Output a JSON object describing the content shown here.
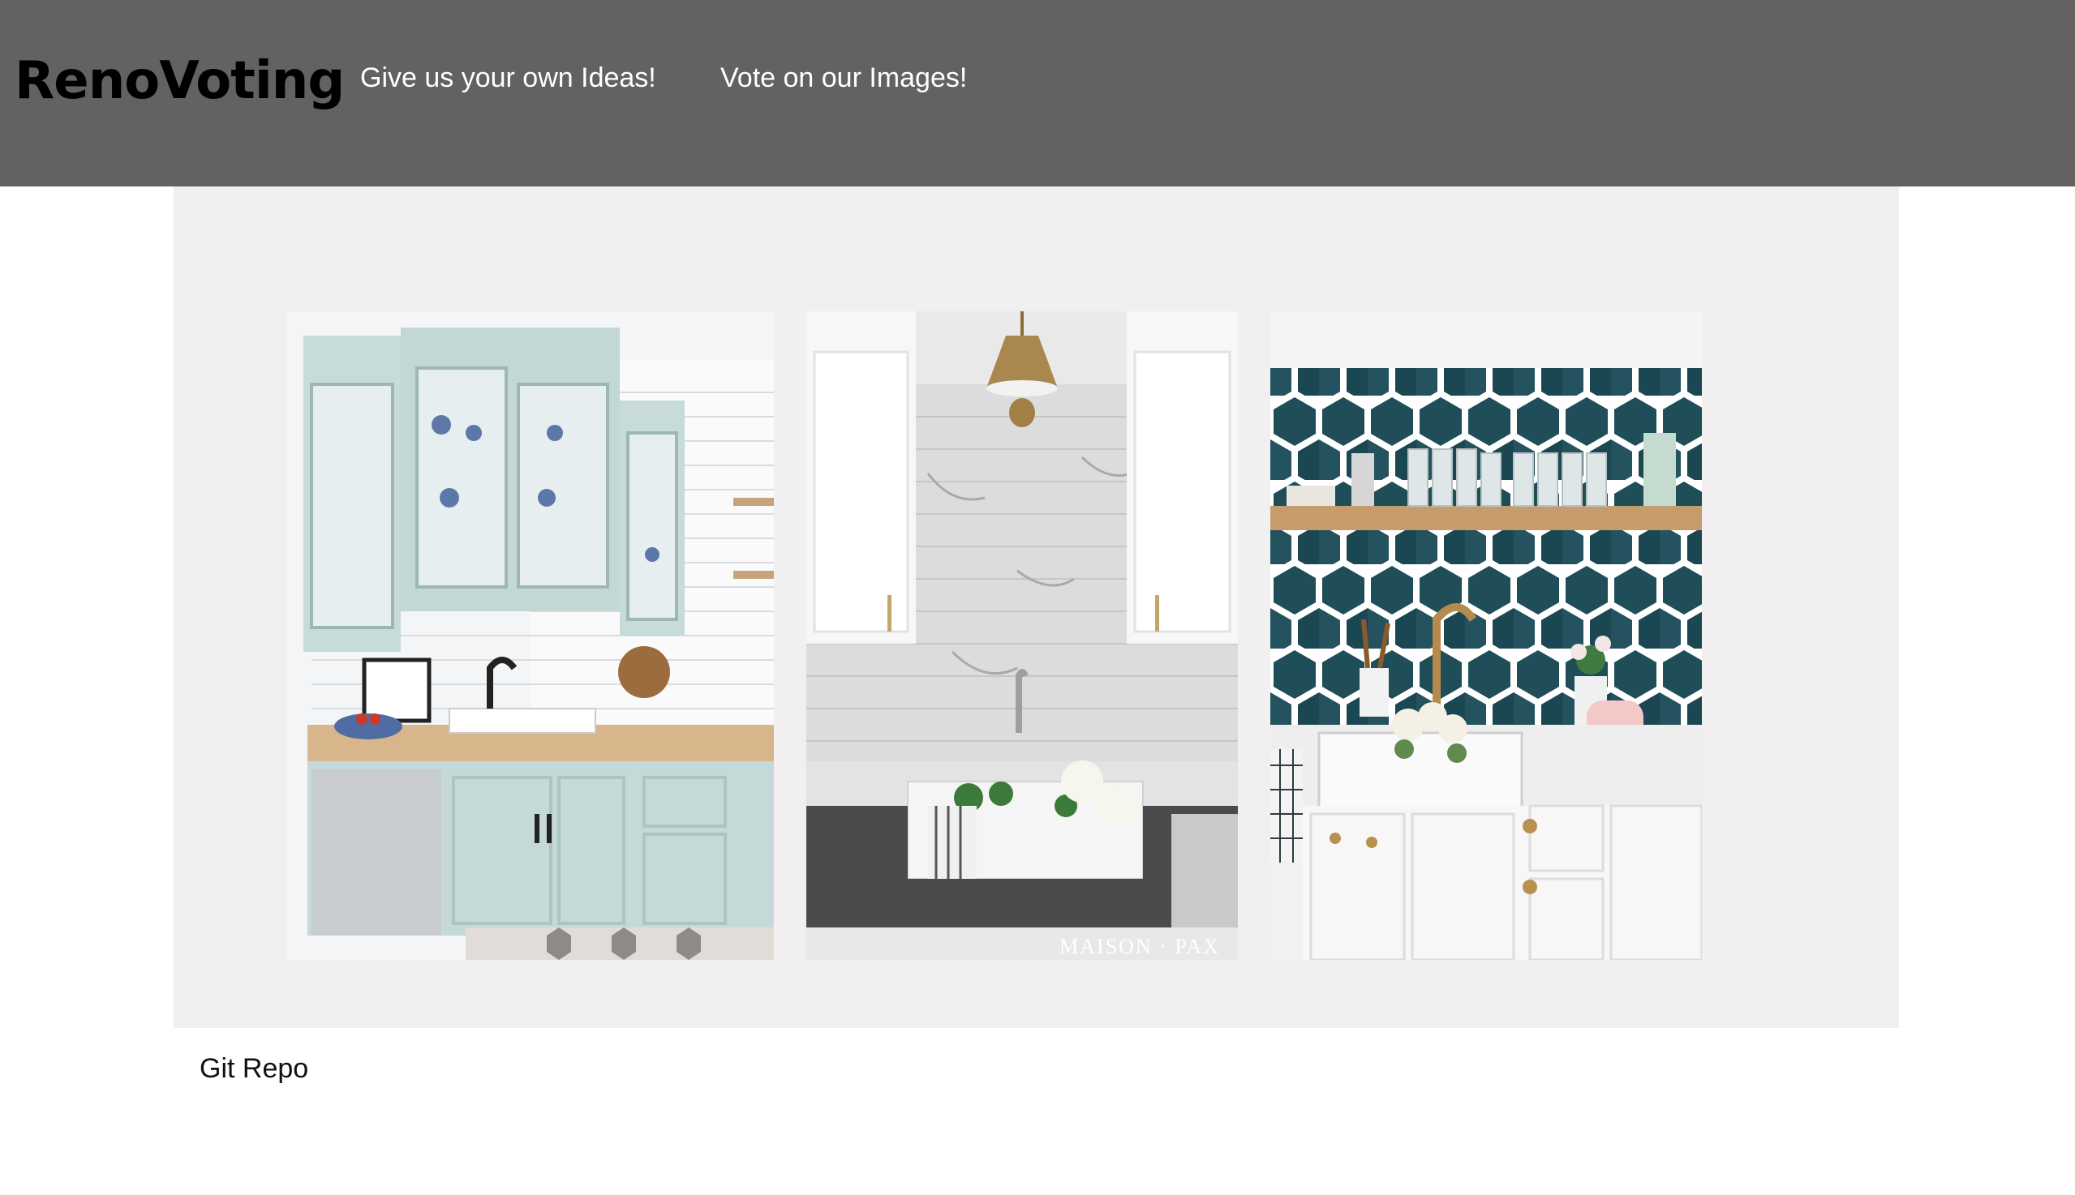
{
  "header": {
    "logo": "RenoVoting",
    "nav": [
      {
        "label": "Give us your own Ideas!"
      },
      {
        "label": "Vote on our Images!"
      }
    ],
    "background_color": "#626261"
  },
  "gallery": {
    "background_color": "#f1efef",
    "images": [
      {
        "subject": "light blue kitchen cabinets with white subway tile"
      },
      {
        "subject": "white kitchen with marble backsplash and farmhouse sink",
        "watermark": "MAISON · PAX"
      },
      {
        "subject": "teal hexagon tile backsplash with open wood shelf"
      }
    ]
  },
  "footer": {
    "link": "Git Repo"
  }
}
